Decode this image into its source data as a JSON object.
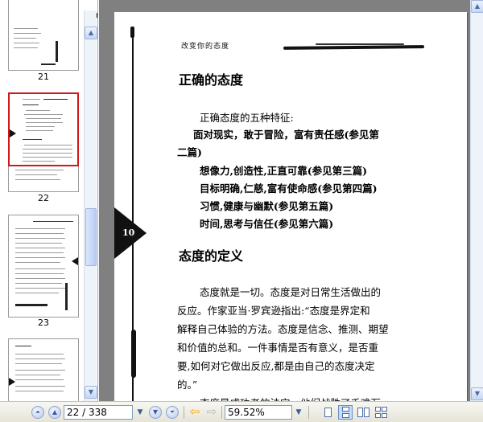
{
  "thumbnails": [
    {
      "label": "21"
    },
    {
      "label": "22"
    },
    {
      "label": "23"
    }
  ],
  "page": {
    "running_head": "改变你的态度",
    "heading1": "正确的态度",
    "intro": "正确态度的五种特征:",
    "traits": [
      "面对现实，敢于冒险，富有责任感(参见第",
      "二篇)",
      "想像力,创造性,正直可靠(参见第三篇)",
      "目标明确,仁慈,富有使命感(参见第四篇)",
      "习惯,健康与幽默(参见第五篇)",
      "时间,思考与信任(参见第六篇)"
    ],
    "chapter_tab": "10",
    "heading2": "态度的定义",
    "body": [
      "态度就是一切。态度是对日常生活做出的",
      "反应。作家亚当·罗宾逊指出:“态度是界定和",
      "解释自己体验的方法。态度是信念、推测、期望",
      "和价值的总和。一件事情是否有意义，是否重",
      "要,如何对它做出反应,都是由自己的态度决定",
      "的。”",
      "态度是成功者的法宝。他们战胜了千难万"
    ]
  },
  "navigation": {
    "page_indicator": "22 / 338",
    "zoom_level": "59.52%"
  },
  "icons": {
    "first_page": "first-page-icon",
    "prev_page": "previous-page-icon",
    "next_page": "next-page-icon",
    "last_page": "last-page-icon",
    "back": "back-arrow-icon",
    "forward": "forward-arrow-icon"
  },
  "colors": {
    "selection": "#d31616",
    "viewport": "#808080",
    "back_arrow": "#f2a81d"
  }
}
